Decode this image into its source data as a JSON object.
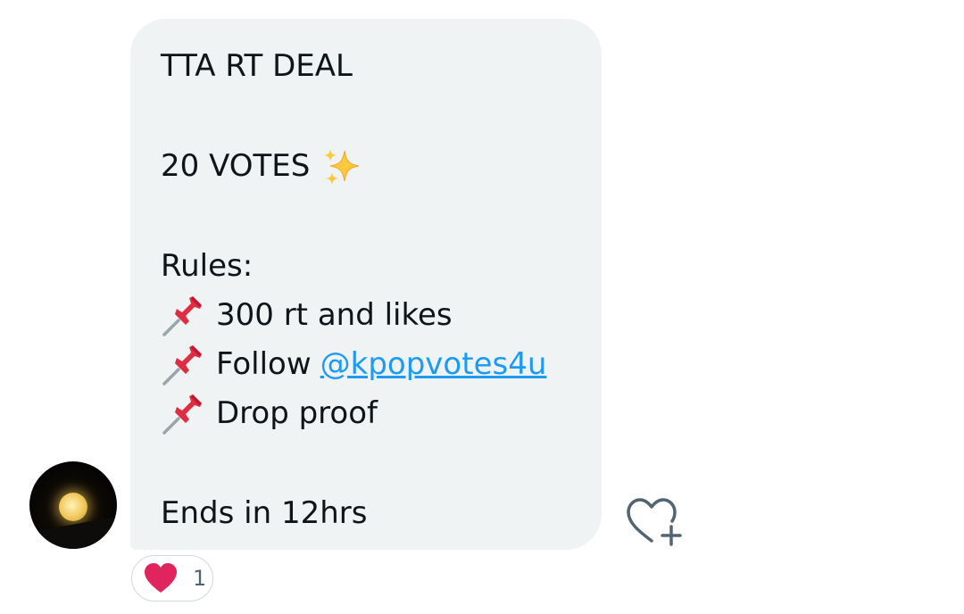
{
  "message": {
    "title": "TTA RT DEAL",
    "votes": "20 VOTES",
    "rules_heading": "Rules:",
    "rule_1": "300 rt and likes",
    "rule_2_prefix": "Follow",
    "rule_2_mention": "@kpopvotes4u",
    "rule_3": "Drop proof",
    "footer": "Ends in 12hrs"
  },
  "icons": {
    "sparkles": "sparkles-emoji",
    "pin": "pushpin-emoji",
    "react": "heart-plus-icon",
    "reaction": "red-heart-icon"
  },
  "reaction": {
    "count": "1"
  },
  "colors": {
    "bubble": "#eff3f4",
    "link": "#1d9bf0",
    "heart": "#e0245e",
    "text": "#0f1419"
  }
}
